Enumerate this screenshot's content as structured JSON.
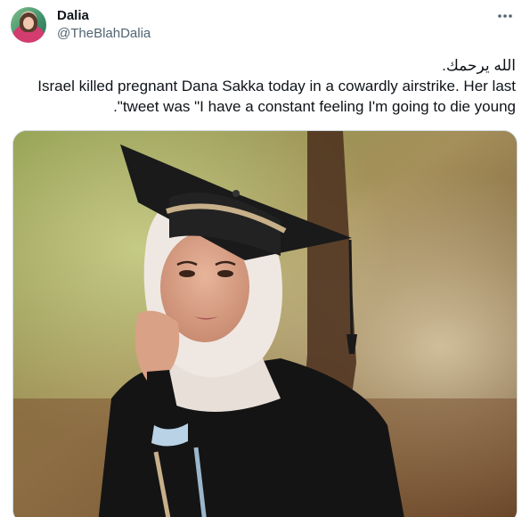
{
  "author": {
    "name": "Dalia",
    "handle": "@TheBlahDalia"
  },
  "tweet": {
    "lines": [
      "الله يرحمك.",
      "Israel killed pregnant Dana Sakka today in a cowardly airstrike. Her last",
      "tweet was \"I have a constant feeling I'm going to die young\"."
    ]
  },
  "icons": {
    "more": "more-horizontal-icon"
  },
  "media": {
    "description": "photo"
  }
}
